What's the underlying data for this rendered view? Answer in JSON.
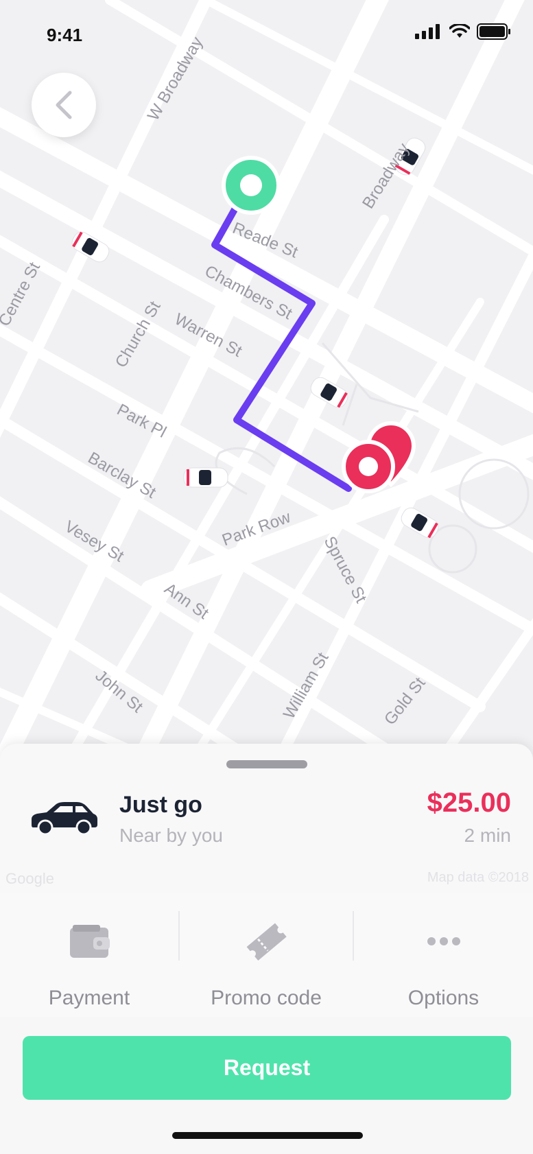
{
  "status_bar": {
    "time": "9:41"
  },
  "map": {
    "streets": [
      {
        "name": "W Broadway"
      },
      {
        "name": "Reade St"
      },
      {
        "name": "Chambers St"
      },
      {
        "name": "Broadway"
      },
      {
        "name": "Centre St"
      },
      {
        "name": "Warren St"
      },
      {
        "name": "Church St"
      },
      {
        "name": "Park Pl"
      },
      {
        "name": "Barclay St"
      },
      {
        "name": "Park Row"
      },
      {
        "name": "Vesey St"
      },
      {
        "name": "Spruce St"
      },
      {
        "name": "Ann St"
      },
      {
        "name": "John St"
      },
      {
        "name": "William St"
      },
      {
        "name": "Gold St"
      }
    ],
    "attribution_left": "Google",
    "attribution_right": "Map data ©2018",
    "route_color": "#6a3df0",
    "origin_color": "#4fdca4",
    "destination_color": "#ea2f5a"
  },
  "ride": {
    "name": "Just go",
    "subtitle": "Near by you",
    "price": "$25.00",
    "eta": "2 min"
  },
  "options": [
    {
      "label": "Payment",
      "icon": "wallet-icon"
    },
    {
      "label": "Promo code",
      "icon": "ticket-icon"
    },
    {
      "label": "Options",
      "icon": "more-icon"
    }
  ],
  "request_label": "Request",
  "colors": {
    "accent": "#4fe3ac",
    "price": "#ea2f5a",
    "car": "#1c2434"
  }
}
